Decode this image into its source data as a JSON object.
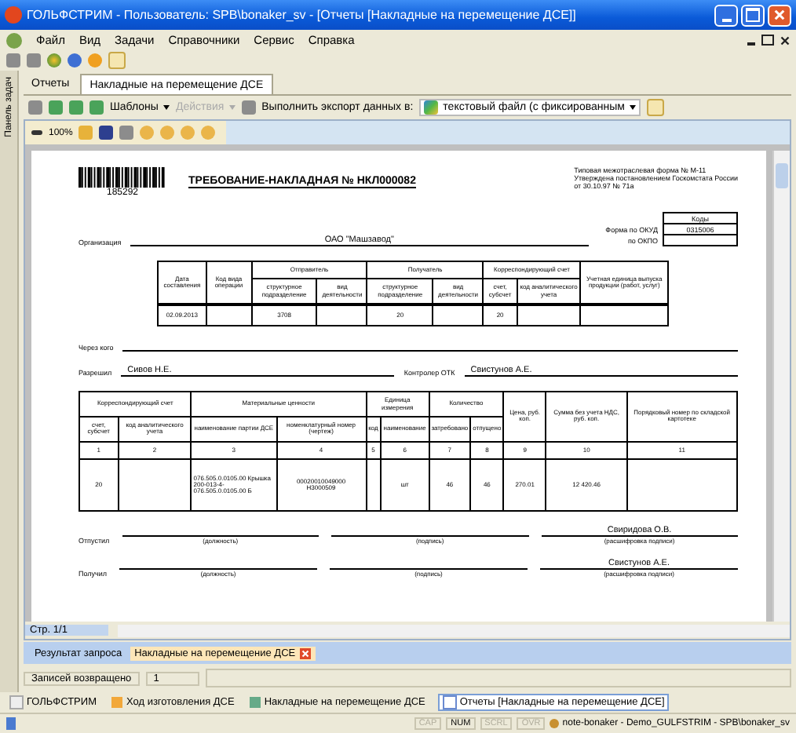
{
  "window": {
    "title": "ГОЛЬФСТРИМ - Пользователь: SPB\\bonaker_sv - [Отчеты [Накладные на перемещение ДСЕ]]"
  },
  "menu": [
    "Файл",
    "Вид",
    "Задачи",
    "Справочники",
    "Сервис",
    "Справка"
  ],
  "side_panel": {
    "label": "Панель задач"
  },
  "doc_tabs": [
    {
      "label": "Отчеты",
      "selected": false
    },
    {
      "label": "Накладные на перемещение ДСЕ",
      "selected": true
    }
  ],
  "report_toolbar": {
    "templates": "Шаблоны",
    "actions": {
      "label": "Действия",
      "disabled": true
    },
    "export_label": "Выполнить экспорт данных в:",
    "export_format": "текстовый файл (с фиксированным"
  },
  "viewer": {
    "zoom": "100%",
    "page": "Стр. 1/1"
  },
  "document": {
    "barcode_number": "185292",
    "title": "ТРЕБОВАНИЕ-НАКЛАДНАЯ № НКЛ000082",
    "form_note": [
      "Типовая межотраслевая форма № М-11",
      "Утверждена постановлением Госкомстата России",
      "от 30.10.97 № 71а"
    ],
    "codes": {
      "heading": "Коды",
      "rows": [
        {
          "label": "Форма по ОКУД",
          "value": "0315006"
        },
        {
          "label": "по ОКПО"
        }
      ]
    },
    "organization": {
      "label": "Организация",
      "value": "ОАО \"Машзавод\""
    },
    "header_table": {
      "header_rows": [
        [
          {
            "label": "Дата составления",
            "rowspan": 2
          },
          {
            "label": "Код вида операции",
            "rowspan": 2
          },
          {
            "label": "Отправитель",
            "colspan": 2
          },
          {
            "label": "Получатель",
            "colspan": 2
          },
          {
            "label": "Корреспондирующий счет",
            "colspan": 2
          },
          {
            "label": "Учетная единица выпуска продукции (работ, услуг)",
            "rowspan": 2
          }
        ],
        [
          {
            "label": "структурное подразделение"
          },
          {
            "label": "вид деятельности"
          },
          {
            "label": "структурное подразделение"
          },
          {
            "label": "вид деятельности"
          },
          {
            "label": "счет, субсчет"
          },
          {
            "label": "код аналитического учета"
          }
        ]
      ],
      "row": {
        "date": "02.09.2013",
        "sender_unit": "3708",
        "receiver_unit": "20",
        "account": "20"
      }
    },
    "via": {
      "label": "Через кого"
    },
    "approvals": [
      {
        "label": "Разрешил",
        "value": "Сивов Н.Е."
      },
      {
        "label": "Контролер ОТК",
        "value": "Свистунов А.Е."
      }
    ],
    "items_table": {
      "header_rows": [
        [
          {
            "label": "Корреспондирующий счет",
            "colspan": 2
          },
          {
            "label": "Материальные ценности",
            "colspan": 2
          },
          {
            "label": "Единица измерения",
            "colspan": 2
          },
          {
            "label": "Количество",
            "colspan": 2
          },
          {
            "label": "Цена, руб. коп.",
            "rowspan": 2
          },
          {
            "label": "Сумма без учета НДС, руб. коп.",
            "rowspan": 2
          },
          {
            "label": "Порядковый номер по складской картотеке",
            "rowspan": 2
          }
        ],
        [
          {
            "label": "счет, субсчет"
          },
          {
            "label": "код аналитического учета"
          },
          {
            "label": "наименование партии ДСЕ"
          },
          {
            "label": "номенклатурный номер (чертеж)"
          },
          {
            "label": "код"
          },
          {
            "label": "наименование"
          },
          {
            "label": "затребовано"
          },
          {
            "label": "отпущено"
          }
        ]
      ],
      "numbers": [
        "1",
        "2",
        "3",
        "4",
        "5",
        "6",
        "7",
        "8",
        "9",
        "10",
        "11"
      ],
      "rows": [
        {
          "account": "20",
          "name": "076.505.0.0105.00 Крышка\n200-013-4-076.505.0.0105.00 Б",
          "number": "00020010049000\nН3000509",
          "unit": "шт",
          "requested": "46",
          "released": "46",
          "price": "270.01",
          "sum": "12 420.46"
        }
      ]
    },
    "signatures": [
      {
        "role": "Отпустил",
        "position_hint": "(должность)",
        "signature_hint": "(подпись)",
        "name": "Свиридова О.В.",
        "name_hint": "(расшифровка подписи)"
      },
      {
        "role": "Получил",
        "position_hint": "(должность)",
        "signature_hint": "(подпись)",
        "name": "Свистунов А.Е.",
        "name_hint": "(расшифровка подписи)"
      }
    ]
  },
  "result_tabs": [
    {
      "label": "Результат запроса",
      "selected": false,
      "closable": false
    },
    {
      "label": "Накладные на перемещение ДСЕ",
      "selected": true,
      "closable": true
    }
  ],
  "records": {
    "label": "Записей возвращено",
    "value": "1"
  },
  "taskbar": [
    {
      "label": "ГОЛЬФСТРИМ",
      "selected": false
    },
    {
      "label": "Ход изготовления ДСЕ",
      "selected": false
    },
    {
      "label": "Накладные на перемещение ДСЕ",
      "selected": false
    },
    {
      "label": "Отчеты [Накладные на перемещение ДСЕ]",
      "selected": true
    }
  ],
  "status_bar": {
    "indicators": [
      {
        "label": "CAP",
        "on": false
      },
      {
        "label": "NUM",
        "on": true
      },
      {
        "label": "SCRL",
        "on": false
      },
      {
        "label": "OVR",
        "on": false
      }
    ],
    "connection": "note-bonaker - Demo_GULFSTRIM - SPB\\bonaker_sv"
  }
}
